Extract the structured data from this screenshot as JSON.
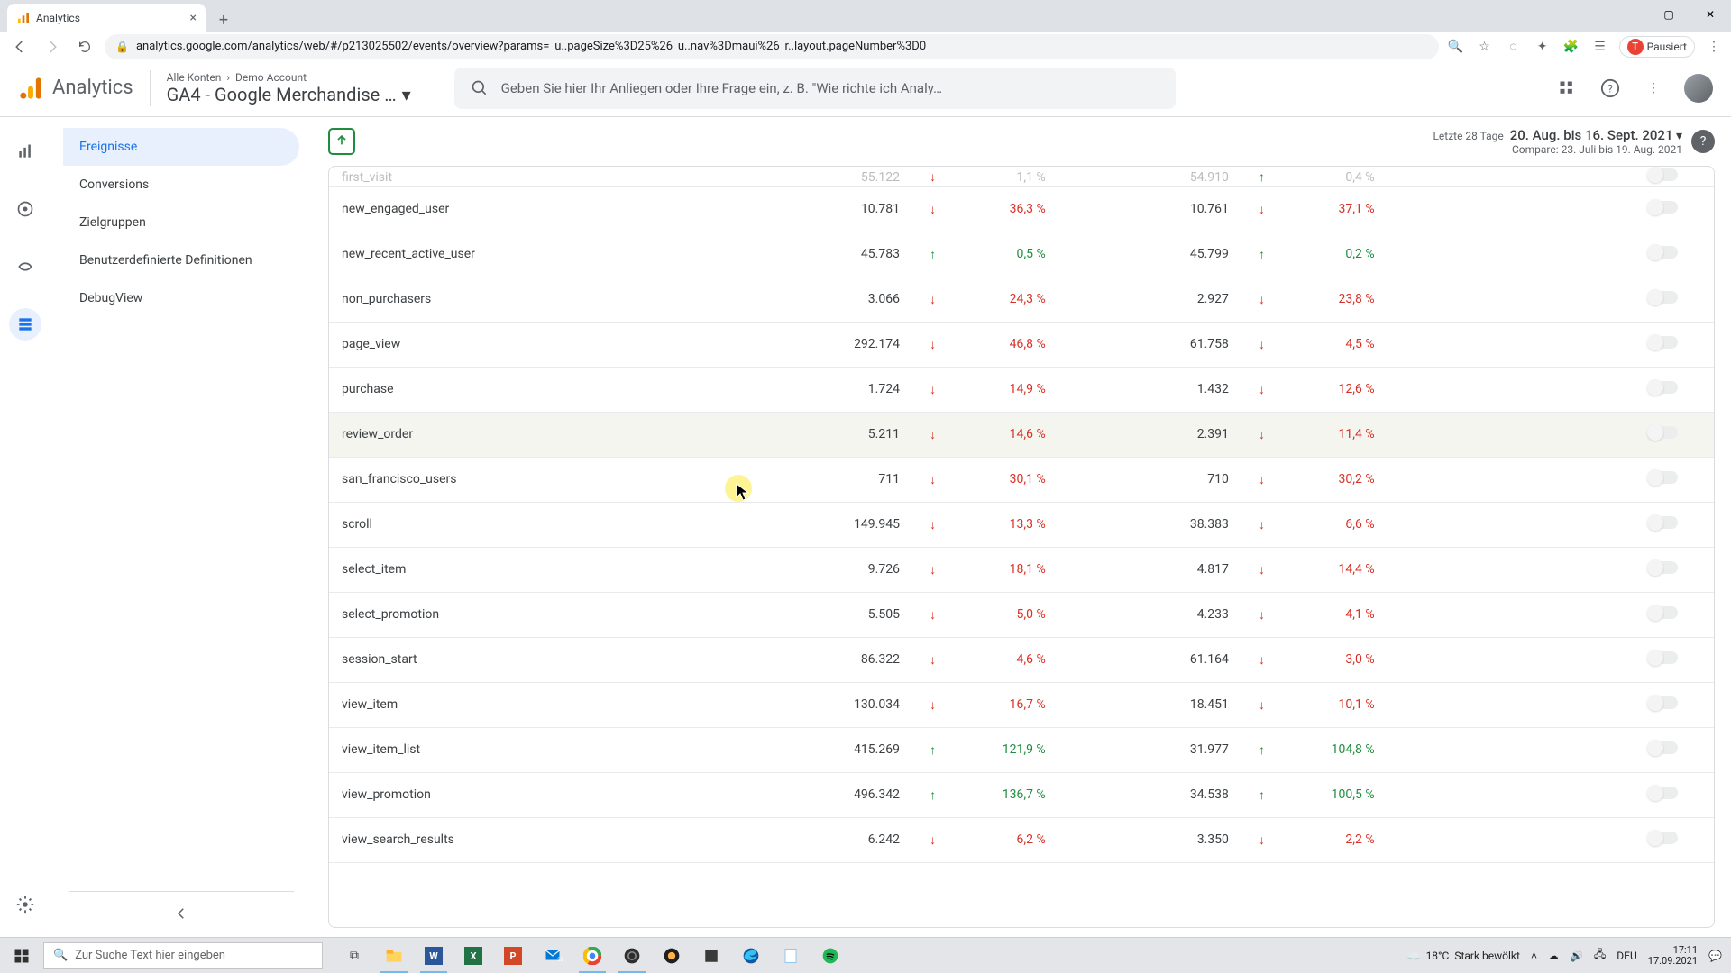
{
  "chrome": {
    "tab_title": "Analytics",
    "url": "analytics.google.com/analytics/web/#/p213025502/events/overview?params=_u..pageSize%3D25%26_u..nav%3Dmaui%26_r..layout.pageNumber%3D0",
    "pause_label": "Pausiert",
    "avatar_letter": "T"
  },
  "ga_header": {
    "brand": "Analytics",
    "crumb1": "Alle Konten",
    "crumb2": "Demo Account",
    "property": "GA4 - Google Merchandise …",
    "search_placeholder": "Geben Sie hier Ihr Anliegen oder Ihre Frage ein, z. B. \"Wie richte ich Analy…"
  },
  "sidebar": {
    "items": [
      {
        "label": "Ereignisse"
      },
      {
        "label": "Conversions"
      },
      {
        "label": "Zielgruppen"
      },
      {
        "label": "Benutzerdefinierte Definitionen"
      },
      {
        "label": "DebugView"
      }
    ]
  },
  "date": {
    "last_label": "Letzte 28 Tage",
    "range": "20. Aug. bis 16. Sept. 2021",
    "compare": "Compare: 23. Juli bis 19. Aug. 2021"
  },
  "rows": [
    {
      "name": "first_visit",
      "v1": "55.122",
      "d1": "down",
      "p1": "1,1 %",
      "v2": "54.910",
      "d2": "up",
      "p2": "0,4 %",
      "cut": true
    },
    {
      "name": "new_engaged_user",
      "v1": "10.781",
      "d1": "down",
      "p1": "36,3 %",
      "v2": "10.761",
      "d2": "down",
      "p2": "37,1 %"
    },
    {
      "name": "new_recent_active_user",
      "v1": "45.783",
      "d1": "up",
      "p1": "0,5 %",
      "v2": "45.799",
      "d2": "up",
      "p2": "0,2 %"
    },
    {
      "name": "non_purchasers",
      "v1": "3.066",
      "d1": "down",
      "p1": "24,3 %",
      "v2": "2.927",
      "d2": "down",
      "p2": "23,8 %"
    },
    {
      "name": "page_view",
      "v1": "292.174",
      "d1": "down",
      "p1": "46,8 %",
      "v2": "61.758",
      "d2": "down",
      "p2": "4,5 %"
    },
    {
      "name": "purchase",
      "v1": "1.724",
      "d1": "down",
      "p1": "14,9 %",
      "v2": "1.432",
      "d2": "down",
      "p2": "12,6 %"
    },
    {
      "name": "review_order",
      "v1": "5.211",
      "d1": "down",
      "p1": "14,6 %",
      "v2": "2.391",
      "d2": "down",
      "p2": "11,4 %",
      "hover": true
    },
    {
      "name": "san_francisco_users",
      "v1": "711",
      "d1": "down",
      "p1": "30,1 %",
      "v2": "710",
      "d2": "down",
      "p2": "30,2 %"
    },
    {
      "name": "scroll",
      "v1": "149.945",
      "d1": "down",
      "p1": "13,3 %",
      "v2": "38.383",
      "d2": "down",
      "p2": "6,6 %"
    },
    {
      "name": "select_item",
      "v1": "9.726",
      "d1": "down",
      "p1": "18,1 %",
      "v2": "4.817",
      "d2": "down",
      "p2": "14,4 %"
    },
    {
      "name": "select_promotion",
      "v1": "5.505",
      "d1": "down",
      "p1": "5,0 %",
      "v2": "4.233",
      "d2": "down",
      "p2": "4,1 %"
    },
    {
      "name": "session_start",
      "v1": "86.322",
      "d1": "down",
      "p1": "4,6 %",
      "v2": "61.164",
      "d2": "down",
      "p2": "3,0 %"
    },
    {
      "name": "view_item",
      "v1": "130.034",
      "d1": "down",
      "p1": "16,7 %",
      "v2": "18.451",
      "d2": "down",
      "p2": "10,1 %"
    },
    {
      "name": "view_item_list",
      "v1": "415.269",
      "d1": "up",
      "p1": "121,9 %",
      "v2": "31.977",
      "d2": "up",
      "p2": "104,8 %"
    },
    {
      "name": "view_promotion",
      "v1": "496.342",
      "d1": "up",
      "p1": "136,7 %",
      "v2": "34.538",
      "d2": "up",
      "p2": "100,5 %"
    },
    {
      "name": "view_search_results",
      "v1": "6.242",
      "d1": "down",
      "p1": "6,2 %",
      "v2": "3.350",
      "d2": "down",
      "p2": "2,2 %"
    }
  ],
  "taskbar": {
    "search_placeholder": "Zur Suche Text hier eingeben",
    "weather_temp": "18°C",
    "weather_text": "Stark bewölkt",
    "lang": "DEU",
    "time": "17:11",
    "date": "17.09.2021"
  }
}
